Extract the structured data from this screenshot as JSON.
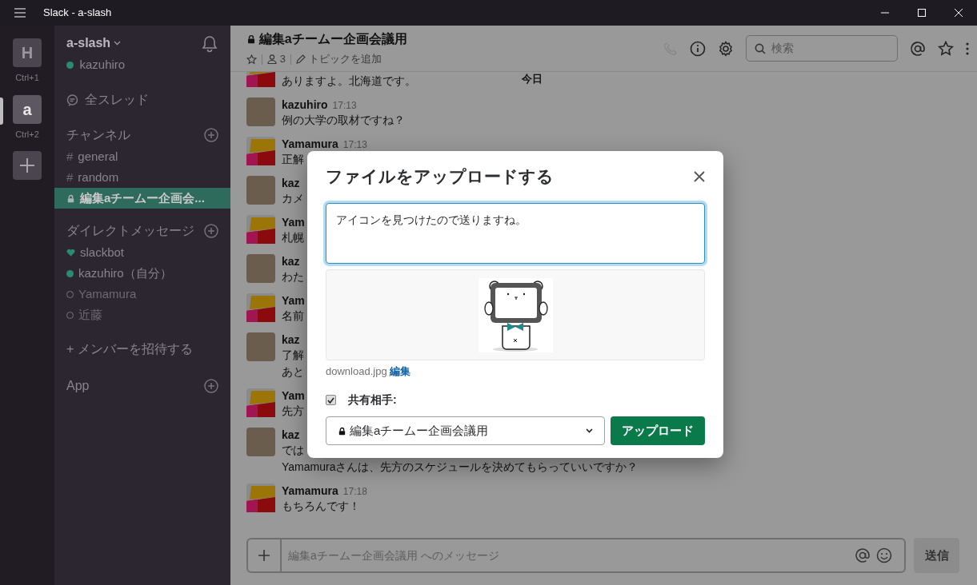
{
  "window": {
    "title": "Slack - a-slash"
  },
  "workspaces": [
    {
      "initial": "H",
      "shortcut": "Ctrl+1",
      "selected": false
    },
    {
      "initial": "a",
      "shortcut": "Ctrl+2",
      "selected": true
    }
  ],
  "sidebar": {
    "team": "a-slash",
    "user": "kazuhiro",
    "threads": "全スレッド",
    "channels": {
      "title": "チャンネル",
      "items": [
        {
          "kind": "public",
          "prefix": "#",
          "label": "general",
          "selected": false
        },
        {
          "kind": "public",
          "prefix": "#",
          "label": "random",
          "selected": false
        },
        {
          "kind": "private",
          "label": "編集aチームー企画会...",
          "selected": true
        }
      ]
    },
    "direct": {
      "title": "ダイレクトメッセージ",
      "items": [
        {
          "kind": "bot",
          "label": "slackbot"
        },
        {
          "kind": "online",
          "label": "kazuhiro（自分）"
        },
        {
          "kind": "away",
          "label": "Yamamura"
        },
        {
          "kind": "away",
          "label": "近藤"
        }
      ]
    },
    "invite": "+ メンバーを招待する",
    "apps": "App"
  },
  "channel": {
    "title": "編集aチームー企画会議用",
    "members": "3",
    "topic": "トピックを追加",
    "search_placeholder": "検索",
    "date_divider": "今日"
  },
  "messages": [
    {
      "kind": "pattern",
      "lines": [
        "ありますよ。北海道です。"
      ]
    },
    {
      "kind": "photo",
      "name": "kazuhiro",
      "time": "17:13",
      "lines": [
        "例の大学の取材ですね？"
      ]
    },
    {
      "kind": "pattern",
      "name": "Yamamura",
      "time": "17:13",
      "lines": [
        "正解"
      ]
    },
    {
      "kind": "photo",
      "name": "kaz",
      "lines": [
        "カメ"
      ]
    },
    {
      "kind": "pattern",
      "name": "Yam",
      "lines": [
        "札幌"
      ]
    },
    {
      "kind": "photo",
      "name": "kaz",
      "lines": [
        "わた"
      ]
    },
    {
      "kind": "pattern",
      "name": "Yam",
      "lines": [
        "名前"
      ]
    },
    {
      "kind": "photo",
      "name": "kaz",
      "lines": [
        "了解",
        "あと"
      ]
    },
    {
      "kind": "pattern",
      "name": "Yam",
      "lines": [
        "先方"
      ]
    },
    {
      "kind": "photo",
      "name": "kaz",
      "lines": [
        "では",
        "Yamamuraさんは、先方のスケジュールを決めてもらっていいですか？"
      ]
    },
    {
      "kind": "pattern",
      "name": "Yamamura",
      "time": "17:18",
      "lines": [
        "もちろんです！"
      ]
    }
  ],
  "composer": {
    "placeholder": "編集aチームー企画会議用 へのメッセージ",
    "send": "送信"
  },
  "modal": {
    "title": "ファイルをアップロードする",
    "message": "アイコンを見つけたので送りますね。",
    "file_name": "download.jpg",
    "edit_link": "編集",
    "share_label": "共有相手:",
    "share_checked": true,
    "share_target": "編集aチームー企画会議用",
    "upload": "アップロード"
  }
}
